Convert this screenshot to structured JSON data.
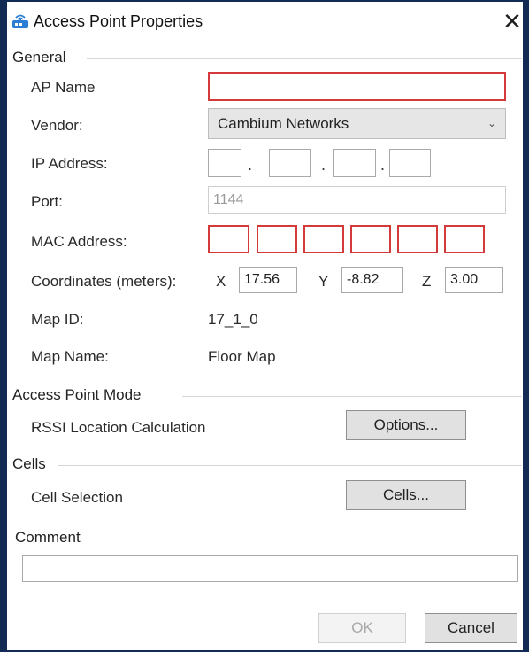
{
  "window": {
    "title": "Access Point Properties",
    "close_glyph": "✕"
  },
  "general": {
    "header": "General",
    "ap_name": {
      "label": "AP Name",
      "value": ""
    },
    "vendor": {
      "label": "Vendor:",
      "selected": "Cambium Networks"
    },
    "ip_address": {
      "label": "IP Address:",
      "octets": [
        "",
        "",
        "",
        ""
      ],
      "separator": "."
    },
    "port": {
      "label": "Port:",
      "value": "1144"
    },
    "mac_address": {
      "label": "MAC Address:",
      "parts": [
        "",
        "",
        "",
        "",
        "",
        ""
      ]
    },
    "coordinates": {
      "label": "Coordinates (meters):",
      "x_label": "X",
      "x_value": "17.56",
      "y_label": "Y",
      "y_value": "-8.82",
      "z_label": "Z",
      "z_value": "3.00"
    },
    "map_id": {
      "label": "Map ID:",
      "value": "17_1_0"
    },
    "map_name": {
      "label": "Map Name:",
      "value": "Floor Map"
    }
  },
  "mode": {
    "header": "Access Point Mode",
    "label": "RSSI Location Calculation",
    "button": "Options..."
  },
  "cells": {
    "header": "Cells",
    "label": "Cell Selection",
    "button": "Cells..."
  },
  "comment": {
    "header": "Comment",
    "value": ""
  },
  "footer": {
    "ok": "OK",
    "cancel": "Cancel"
  },
  "colors": {
    "frame": "#132a55",
    "error_border": "#d43a3a",
    "icon": "#2a7fd4"
  },
  "icons": {
    "title": "access-point-icon",
    "dropdown": "chevron-down-icon",
    "close": "close-icon"
  }
}
